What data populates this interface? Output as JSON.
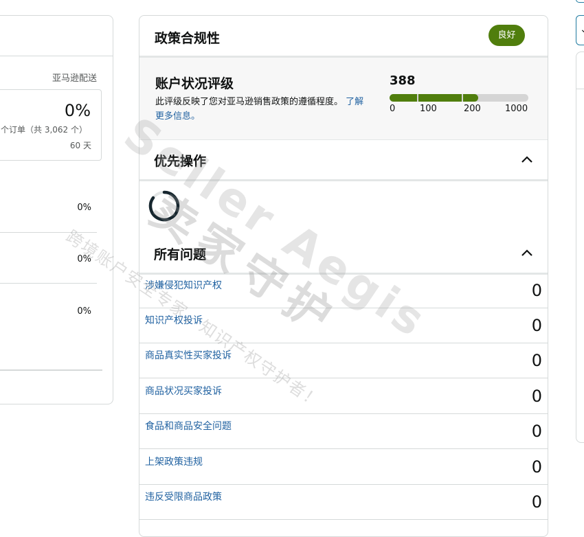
{
  "left_panel": {
    "fba_label": "亚马逊配送",
    "main_percent": "0%",
    "orders_text": "个订单（共 3,062 个）",
    "days_text": "60 天",
    "row_percents": [
      "0%",
      "0%",
      "0%"
    ]
  },
  "center_panel": {
    "title": "政策合规性",
    "status_badge": "良好",
    "ahr": {
      "title": "账户状况评级",
      "description": "此评级反映了您对亚马逊销售政策的遵循程度。",
      "link_text": "了解更多信息。",
      "score": "388",
      "score_fraction": 0.64,
      "ticks": [
        "0",
        "100",
        "200",
        "1000"
      ]
    },
    "priority_actions": {
      "title": "优先操作",
      "loading": true
    },
    "all_issues": {
      "title": "所有问题",
      "items": [
        {
          "name": "涉嫌侵犯知识产权",
          "count": "0"
        },
        {
          "name": "知识产权投诉",
          "count": "0"
        },
        {
          "name": "商品真实性买家投诉",
          "count": "0"
        },
        {
          "name": "商品状况买家投诉",
          "count": "0"
        },
        {
          "name": "食品和商品安全问题",
          "count": "0"
        },
        {
          "name": "上架政策违规",
          "count": "0"
        },
        {
          "name": "违反受限商品政策",
          "count": "0"
        }
      ]
    }
  },
  "watermark": {
    "line1": "Seller Aegis",
    "line2": "卖家守护",
    "line3": "跨境账户安全专家，知识产权守护者！"
  },
  "colors": {
    "accent_green": "#507e0d",
    "link_blue": "#2162a1",
    "border": "#d5d9d9"
  },
  "icons": {
    "collapse": "chevron-up-icon",
    "loading": "spinner-icon",
    "dropdown": "chevron-down-icon"
  }
}
